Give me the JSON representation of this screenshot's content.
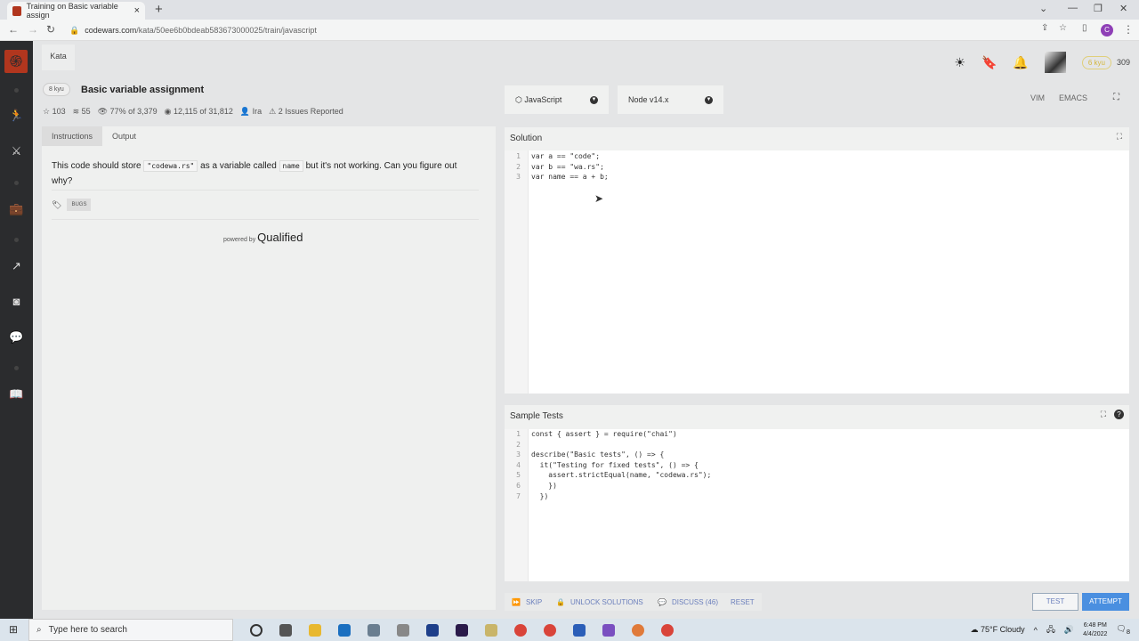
{
  "browser": {
    "tab_title": "Training on Basic variable assign",
    "url_host": "codewars.com",
    "url_path": "/kata/50ee6b0bdeab583673000025/train/javascript"
  },
  "header": {
    "breadcrumb": "Kata",
    "rank": "6 kyu",
    "honor": "309"
  },
  "kata": {
    "kyu": "8 kyu",
    "title": "Basic variable assignment",
    "stars": "103",
    "collections": "55",
    "satisfaction": "77% of 3,379",
    "completed": "12,115 of 31,812",
    "author": "Ira",
    "issues": "2 Issues Reported"
  },
  "left": {
    "tabs": [
      "Instructions",
      "Output"
    ],
    "desc_1": "This code should store ",
    "desc_code1": "\"codewa.rs\"",
    "desc_2": " as a variable called ",
    "desc_code2": "name",
    "desc_3": " but it's not working. Can you figure out why?",
    "tag": "BUGS",
    "powered_by": "powered by",
    "qualified": "Qualified"
  },
  "editor": {
    "language": "JavaScript",
    "version": "Node v14.x",
    "modes": [
      "VIM",
      "EMACS"
    ],
    "solution_title": "Solution",
    "tests_title": "Sample Tests"
  },
  "solution_lines": [
    "var a == \"code\";",
    "var b == \"wa.rs\";",
    "var name == a + b;"
  ],
  "test_lines": [
    "const { assert } = require(\"chai\")",
    "",
    "describe(\"Basic tests\", () => {",
    "  it(\"Testing for fixed tests\", () => {",
    "    assert.strictEqual(name, \"codewa.rs\");",
    "    })",
    "  })"
  ],
  "actions": {
    "skip": "SKIP",
    "unlock": "UNLOCK SOLUTIONS",
    "discuss": "DISCUSS (46)",
    "reset": "RESET",
    "test": "TEST",
    "attempt": "ATTEMPT"
  },
  "taskbar": {
    "search_placeholder": "Type here to search",
    "weather": "75°F  Cloudy",
    "time": "6:48 PM",
    "date": "4/4/2022",
    "notifications": "8"
  },
  "colors": {
    "accent": "#b1361e",
    "attempt": "#4a8fe0",
    "sidebar": "#2b2c2e"
  }
}
